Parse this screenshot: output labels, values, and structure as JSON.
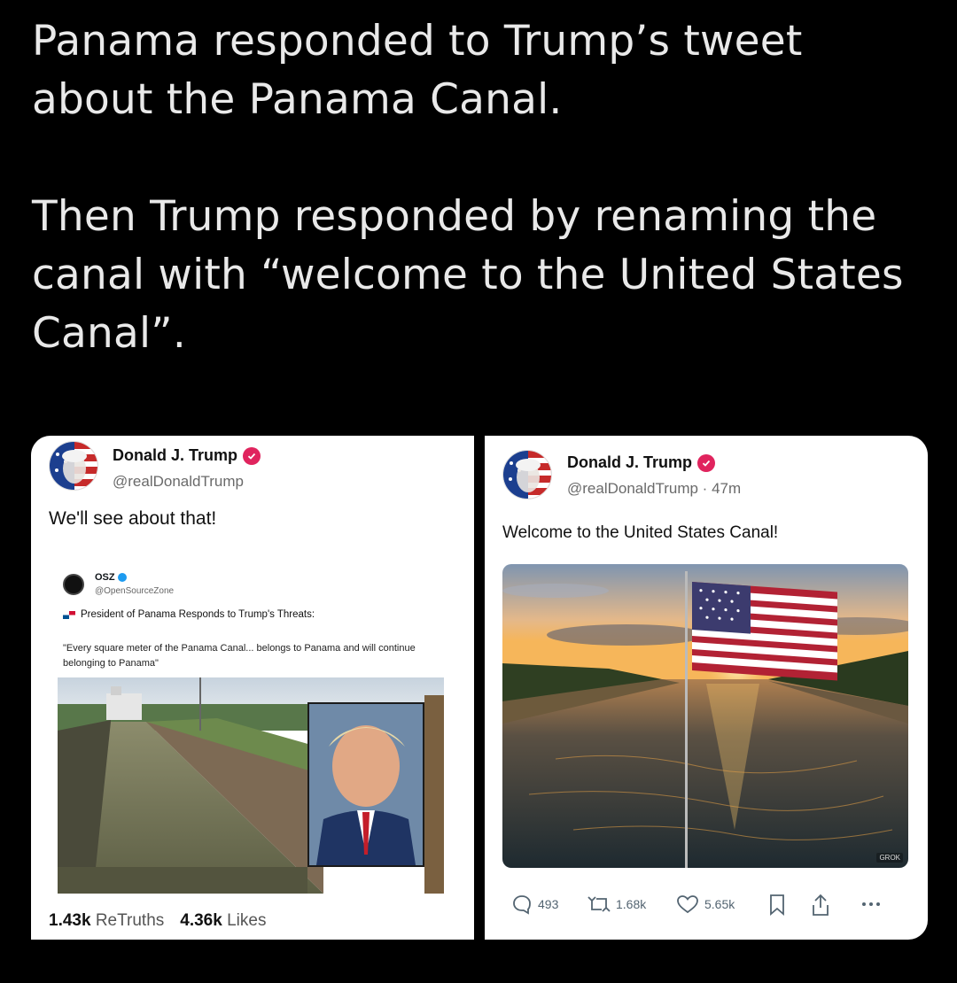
{
  "headline": {
    "line1": "Panama responded to Trump’s tweet about the Panama Canal.",
    "line2": "Then Trump responded by renaming the canal with “welcome to the United States Canal”."
  },
  "left_post": {
    "author_name": "Donald J. Trump",
    "handle": "@realDonaldTrump",
    "text": "We'll see about that!",
    "embedded": {
      "author_name": "OSZ",
      "handle": "@OpenSourceZone",
      "title": "President of Panama Responds to Trump's Threats:",
      "quote": "\"Every square meter of the Panama Canal... belongs to Panama and will continue belonging to Panama\""
    },
    "retruths_count": "1.43k",
    "retruths_label": "ReTruths",
    "likes_count": "4.36k",
    "likes_label": "Likes"
  },
  "right_post": {
    "author_name": "Donald J. Trump",
    "handle": "@realDonaldTrump · 47m",
    "text": "Welcome to the United States Canal!",
    "image_watermark": "GROK",
    "replies": "493",
    "retruths": "1.68k",
    "likes": "5.65k"
  },
  "colors": {
    "background": "#000000",
    "card": "#ffffff",
    "verified_badge": "#e0245e",
    "osz_badge": "#1d9bf0"
  }
}
